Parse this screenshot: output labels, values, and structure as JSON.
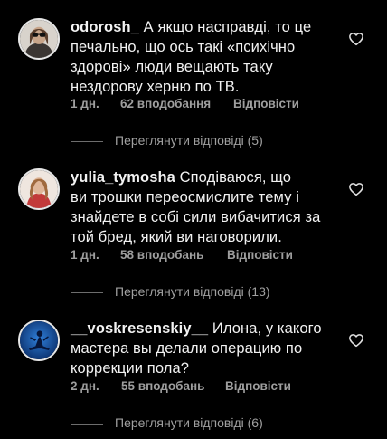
{
  "comments": [
    {
      "username": "odorosh_",
      "text": " А якщо насправді, то це\nпечально, що ось такі «психічно\nздорові» люди вещають таку\nнездорову херню по ТВ.",
      "time": "1 дн.",
      "likes": "62 вподобання",
      "reply": "Відповісти",
      "view_replies": "Переглянути відповіді (5)",
      "avatar_icon": "profile-photo-woman-sunglasses",
      "like_icon": "heart-outline-icon"
    },
    {
      "username": "yulia_tymosha",
      "text": " Сподіваюся, що\nви трошки переосмислите тему і\nзнайдете в собі сили вибачитися за\nтой бред, який ви наговорили.",
      "time": "1 дн.",
      "likes": "58 вподобань",
      "reply": "Відповісти",
      "view_replies": "Переглянути відповіді (13)",
      "avatar_icon": "profile-photo-woman-red-dress",
      "like_icon": "heart-outline-icon"
    },
    {
      "username": "__voskresenskiy__",
      "text": " Илона, у какого\nмастера вы делали операцию по\nкоррекции пола?",
      "time": "2 дн.",
      "likes": "55 вподобань",
      "reply": "Відповісти",
      "view_replies": "Переглянути відповіді (6)",
      "avatar_icon": "profile-photo-blue-silhouette",
      "like_icon": "heart-outline-icon"
    }
  ],
  "colors": {
    "background": "#000000",
    "text": "#f2f2f2",
    "secondary": "#9e9e9e"
  }
}
